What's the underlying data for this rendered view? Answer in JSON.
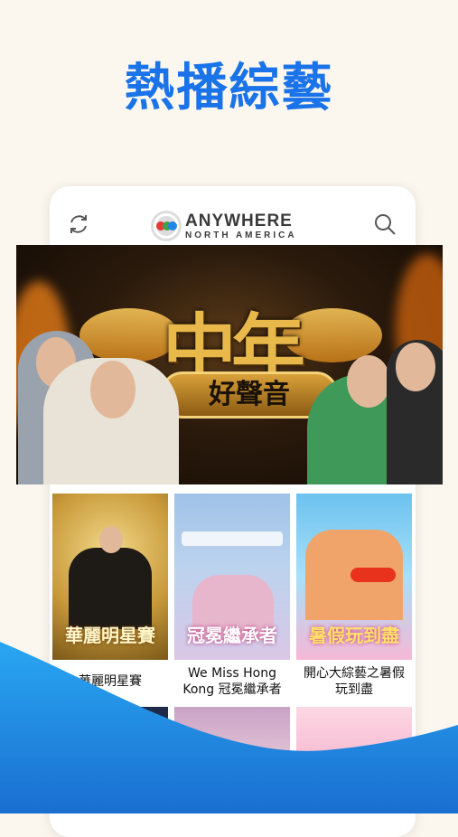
{
  "headline": "熱播綜藝",
  "app": {
    "logo_main": "ANYWHERE",
    "logo_sub": "NORTH AMERICA",
    "refresh_icon": "refresh-icon",
    "search_icon": "search-icon"
  },
  "banner": {
    "title": "中年",
    "subtitle": "好聲音"
  },
  "cards": [
    {
      "title": "華麗明星賽",
      "thumb_text": "華麗明星賽"
    },
    {
      "title": "We Miss Hong Kong 冠冕繼承者",
      "thumb_text": "冠冕繼承者"
    },
    {
      "title": "開心大綜藝之暑假玩到盡",
      "thumb_text": "暑假玩到盡"
    }
  ],
  "colors": {
    "headline": "#1a73e8",
    "wave_top": "#29a6f2",
    "wave_bottom": "#1a6fd0"
  }
}
